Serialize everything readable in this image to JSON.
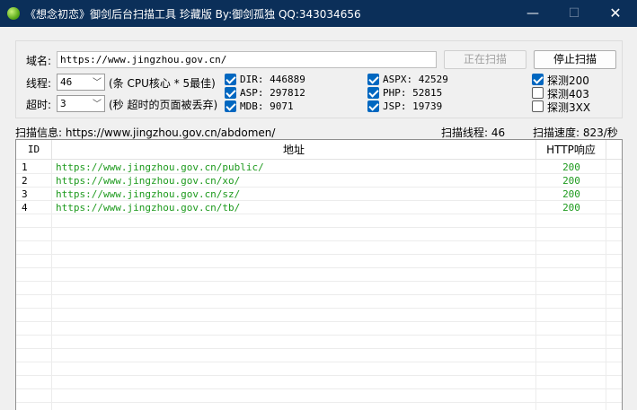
{
  "window": {
    "title": "《想念初恋》御剑后台扫描工具 珍藏版 By:御剑孤独 QQ:343034656",
    "min_glyph": "—",
    "max_glyph": "☐",
    "close_glyph": "✕"
  },
  "config": {
    "domain_label": "域名:",
    "domain_value": "https://www.jingzhou.gov.cn/",
    "threads_label": "线程:",
    "threads_value": "46",
    "threads_hint": "(条 CPU核心 * 5最佳)",
    "timeout_label": "超时:",
    "timeout_value": "3",
    "timeout_hint": "(秒 超时的页面被丢弃)",
    "scan_button": "正在扫描",
    "stop_button": "停止扫描"
  },
  "dicts": [
    {
      "label": "DIR: 446889",
      "checked": true
    },
    {
      "label": "ASP: 297812",
      "checked": true
    },
    {
      "label": "MDB: 9071",
      "checked": true
    },
    {
      "label": "ASPX: 42529",
      "checked": true
    },
    {
      "label": "PHP: 52815",
      "checked": true
    },
    {
      "label": "JSP: 19739",
      "checked": true
    }
  ],
  "probes": [
    {
      "label": "探测200",
      "checked": true
    },
    {
      "label": "探测403",
      "checked": false
    },
    {
      "label": "探测3XX",
      "checked": false
    }
  ],
  "status": {
    "info": "扫描信息: https://www.jingzhou.gov.cn/abdomen/",
    "threads": "扫描线程: 46",
    "speed": "扫描速度: 823/秒"
  },
  "table": {
    "headers": {
      "id": "ID",
      "url": "地址",
      "code": "HTTP响应"
    },
    "rows": [
      {
        "id": "1",
        "url": "https://www.jingzhou.gov.cn/public/",
        "code": "200"
      },
      {
        "id": "2",
        "url": "https://www.jingzhou.gov.cn/xo/",
        "code": "200"
      },
      {
        "id": "3",
        "url": "https://www.jingzhou.gov.cn/sz/",
        "code": "200"
      },
      {
        "id": "4",
        "url": "https://www.jingzhou.gov.cn/tb/",
        "code": "200"
      }
    ]
  },
  "colors": {
    "titlebar": "#0b2f59",
    "checkbox_accent": "#0067c0",
    "result_green": "#1d9a1d"
  }
}
